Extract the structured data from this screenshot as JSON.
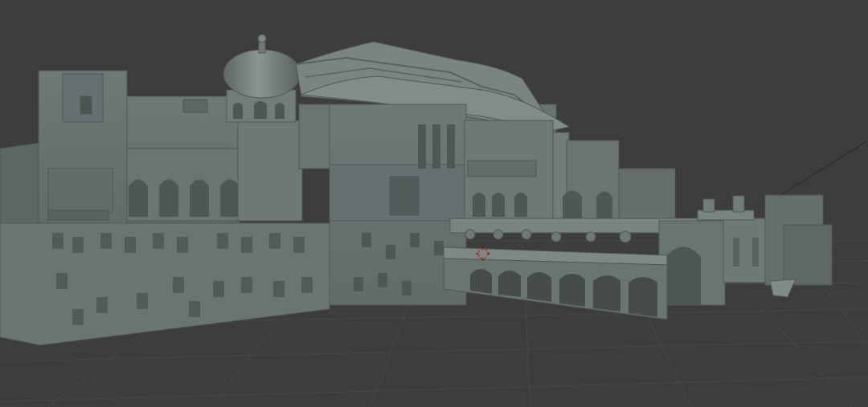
{
  "viewport": {
    "kind": "3d-viewport-solid-shading",
    "background_color": "#3d3d3d",
    "grid_color": "#474747",
    "model_color": "#6b7573",
    "model_shadow_color": "#4f5756",
    "model_highlight_color": "#8b9593",
    "grid_visible": true,
    "cursor_3d": {
      "icon": "3d-cursor-icon",
      "color": "#c0392b"
    },
    "model": {
      "subject": "palace-complex",
      "parts": [
        "left-wing-wall",
        "onion-dome-tower",
        "pagoda-roof-hall",
        "central-facade",
        "arched-bridge",
        "colonnade-terrace",
        "right-pavilion"
      ]
    }
  }
}
